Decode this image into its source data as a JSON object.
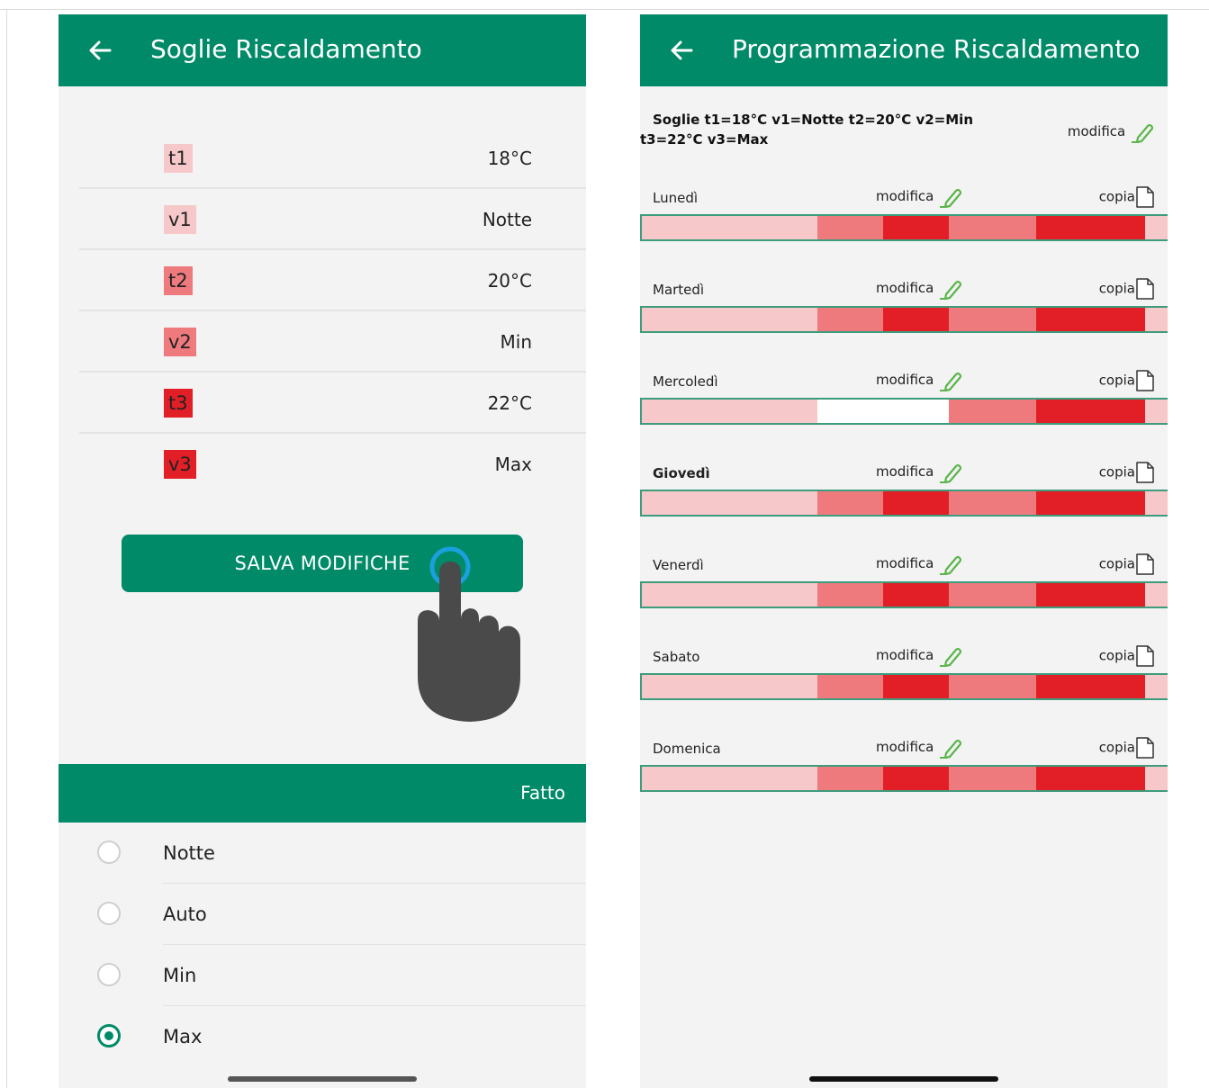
{
  "colors": {
    "primary": "#008a68",
    "light": "#f7c8ca",
    "medium": "#ee7a7e",
    "dark": "#e21f26",
    "off": "#ffffff"
  },
  "left_screen": {
    "title": "Soglie Riscaldamento",
    "back_icon": "arrow-left-icon",
    "thresholds": [
      {
        "tag": "t1",
        "value": "18°C",
        "level": "light"
      },
      {
        "tag": "v1",
        "value": "Notte",
        "level": "light"
      },
      {
        "tag": "t2",
        "value": "20°C",
        "level": "medium"
      },
      {
        "tag": "v2",
        "value": "Min",
        "level": "medium"
      },
      {
        "tag": "t3",
        "value": "22°C",
        "level": "dark"
      },
      {
        "tag": "v3",
        "value": "Max",
        "level": "dark"
      }
    ],
    "save_button": "SALVA MODIFICHE",
    "picker": {
      "done": "Fatto",
      "options": [
        {
          "label": "Notte",
          "selected": false
        },
        {
          "label": "Auto",
          "selected": false
        },
        {
          "label": "Min",
          "selected": false
        },
        {
          "label": "Max",
          "selected": true
        }
      ]
    }
  },
  "right_screen": {
    "title": "Programmazione Riscaldamento",
    "back_icon": "arrow-left-icon",
    "thresholds_line1": "Soglie t1=18°C v1=Notte t2=20°C v2=Min",
    "thresholds_line2": "t3=22°C v3=Max",
    "edit_label": "modifica",
    "copy_label": "copia",
    "days": [
      {
        "name": "Lunedì",
        "bold": false,
        "segments": [
          "light",
          "medium",
          "dark",
          "medium",
          "dark",
          "light"
        ]
      },
      {
        "name": "Martedì",
        "bold": false,
        "segments": [
          "light",
          "medium",
          "dark",
          "medium",
          "dark",
          "light"
        ]
      },
      {
        "name": "Mercoledì",
        "bold": false,
        "segments": [
          "light",
          "off",
          "off",
          "medium",
          "dark",
          "light"
        ]
      },
      {
        "name": "Giovedì",
        "bold": true,
        "segments": [
          "light",
          "medium",
          "dark",
          "medium",
          "dark",
          "light"
        ]
      },
      {
        "name": "Venerdì",
        "bold": false,
        "segments": [
          "light",
          "medium",
          "dark",
          "medium",
          "dark",
          "light"
        ]
      },
      {
        "name": "Sabato",
        "bold": false,
        "segments": [
          "light",
          "medium",
          "dark",
          "medium",
          "dark",
          "light"
        ]
      },
      {
        "name": "Domenica",
        "bold": false,
        "segments": [
          "light",
          "medium",
          "dark",
          "medium",
          "dark",
          "light"
        ]
      }
    ]
  }
}
